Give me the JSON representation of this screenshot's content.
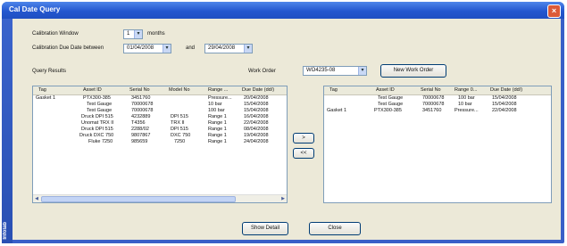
{
  "window": {
    "title": "Cal Date Query",
    "close_label": "×",
    "side_strip_label": "Infolab"
  },
  "filters": {
    "calibration_window_label": "Calibration Window",
    "calibration_window_value": "1",
    "months_label": "months",
    "due_between_label": "Calibration Due Date between",
    "date_from": "01/04/2008",
    "and_label": "and",
    "date_to": "29/04/2008",
    "work_order_label": "Work Order",
    "work_order_value": "WO4235-08",
    "new_work_order_button": "New Work Order"
  },
  "results": {
    "label": "Query Results",
    "columns": [
      "Tag",
      "Asset ID",
      "Serial No",
      "Model No",
      "Range ...",
      "Due Date (dd/)"
    ],
    "rows": [
      [
        "Gasket 1",
        "PTX300-385",
        "3451760",
        "",
        "Pressure...",
        "20/04/2008"
      ],
      [
        "",
        "Test Gauge",
        "70000678",
        "",
        "10 bar",
        "15/04/2008"
      ],
      [
        "",
        "Test Gauge",
        "70000678",
        "",
        "100 bar",
        "15/04/2008"
      ],
      [
        "",
        "Druck DPI 515",
        "4232889",
        "DPI 515",
        "Range 1",
        "16/04/2008"
      ],
      [
        "",
        "Unomat TRX II",
        "T4356",
        "TRX II",
        "Range 1",
        "22/04/2008"
      ],
      [
        "",
        "Druck DPI 515",
        "2288/02",
        "DPI 515",
        "Range 1",
        "08/04/2008"
      ],
      [
        "",
        "Druck DXC 750",
        "9807867",
        "DXC 750",
        "Range 1",
        "19/04/2008"
      ],
      [
        "",
        "Fluke 7250",
        "985659",
        "7250",
        "Range 1",
        "24/04/2008"
      ]
    ]
  },
  "work_order_list": {
    "columns": [
      "Tag",
      "Asset ID",
      "Serial No",
      "Range 0...",
      "Due Date (dd/)"
    ],
    "rows": [
      [
        "",
        "Test Gauge",
        "70000678",
        "100 bar",
        "15/04/2008"
      ],
      [
        "",
        "Test Gauge",
        "70000678",
        "10 bar",
        "15/04/2008"
      ],
      [
        "Gasket 1",
        "PTX300-385",
        "3451760",
        "Pressure...",
        "22/04/2008"
      ]
    ]
  },
  "transfer": {
    "add_label": ">",
    "remove_label": "<<"
  },
  "footer": {
    "show_detail_button": "Show Detail",
    "close_button": "Close"
  }
}
